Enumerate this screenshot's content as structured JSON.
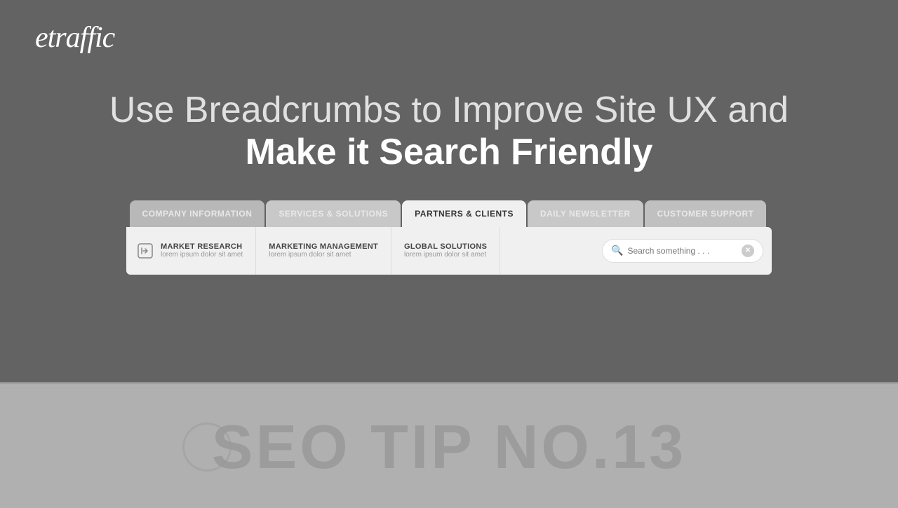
{
  "logo": {
    "text": "etraffic"
  },
  "hero": {
    "line1": "Use Breadcrumbs to Improve Site UX and",
    "line2": "Make it Search Friendly"
  },
  "tabs": [
    {
      "label": "COMPANY INFORMATION",
      "active": false
    },
    {
      "label": "SERVICES & SOLUTIONS",
      "active": false
    },
    {
      "label": "PARTNERS & CLIENTS",
      "active": true
    },
    {
      "label": "DAILY NEWSLETTER",
      "active": false
    },
    {
      "label": "CUSTOMER SUPPORT",
      "active": false
    }
  ],
  "content_items": [
    {
      "title": "MARKET RESEARCH",
      "subtitle": "lorem ipsum dolor sit amet",
      "icon": "arrow-icon"
    },
    {
      "title": "MARKETING MANAGEMENT",
      "subtitle": "lorem ipsum dolor sit amet",
      "icon": ""
    },
    {
      "title": "GLOBAL SOLUTIONS",
      "subtitle": "lorem ipsum dolor sit amet",
      "icon": ""
    }
  ],
  "search": {
    "placeholder": "Search something . . ."
  },
  "seo_tip": {
    "text": "SEO TIP NO.13"
  }
}
